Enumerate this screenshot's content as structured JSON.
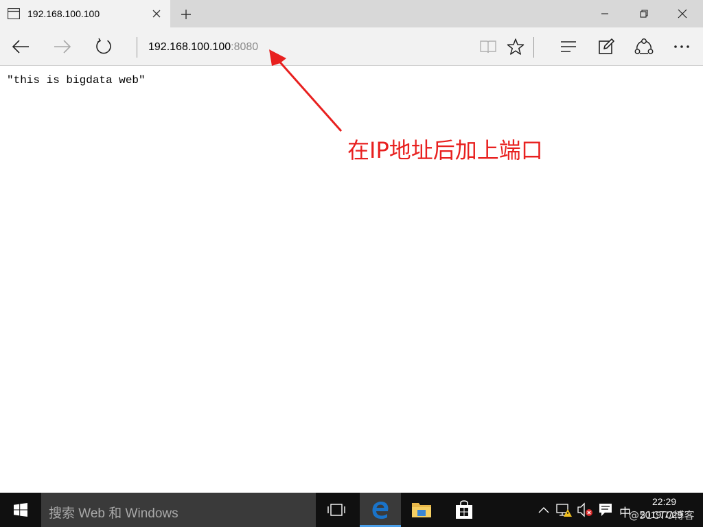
{
  "tab": {
    "title": "192.168.100.100",
    "icon": "tab-page-icon",
    "close_icon": "close-icon",
    "new_tab_icon": "plus-icon"
  },
  "window_controls": [
    "minimize-icon",
    "restore-icon",
    "close-icon"
  ],
  "navbar": {
    "back_icon": "back-arrow-icon",
    "forward_icon": "forward-arrow-icon",
    "refresh_icon": "refresh-icon",
    "address_host": "192.168.100.100",
    "address_port": ":8080",
    "reading_view_icon": "book-icon",
    "favorite_icon": "star-icon",
    "hub_icon": "hub-icon",
    "note_icon": "pen-icon",
    "share_icon": "share-icon",
    "more_icon": "more-icon"
  },
  "page": {
    "content": "\"this is bigdata web\""
  },
  "annotation": {
    "text": "在IP地址后加上端口",
    "color": "#e8201f"
  },
  "taskbar": {
    "search_placeholder": "搜索 Web 和 Windows",
    "apps": [
      "task-view-icon",
      "edge-icon",
      "file-explorer-icon",
      "store-icon"
    ],
    "ime": "中",
    "time": "22:29",
    "date": "2019/7/29",
    "watermark": "@51CTO博客"
  },
  "colors": {
    "tab_strip": "#d8d8d8",
    "navbar": "#f2f2f2",
    "taskbar": "#101010",
    "search_box": "#3a3a3a",
    "edge_blue": "#1a73c8"
  }
}
